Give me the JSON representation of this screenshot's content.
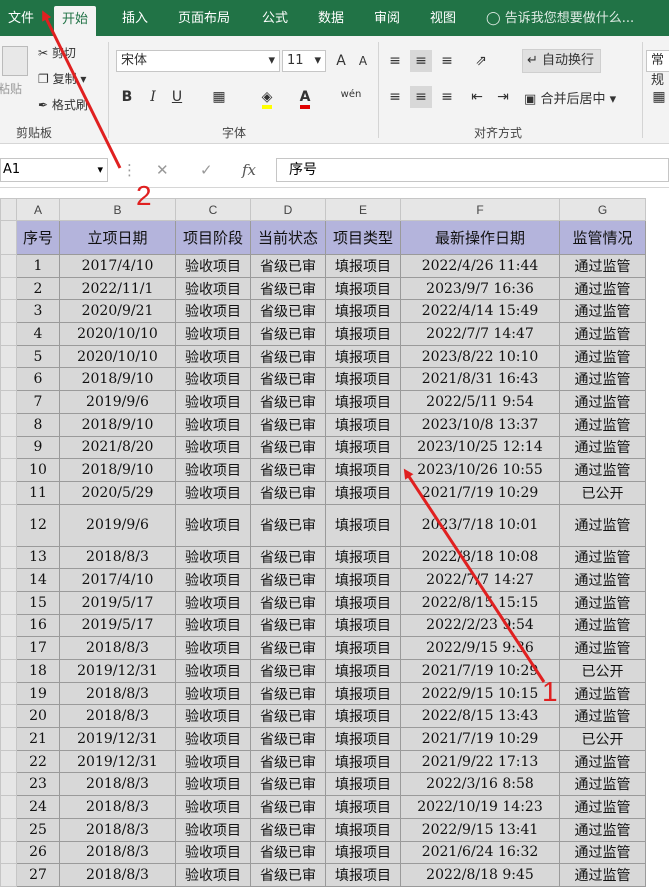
{
  "ribbon_tabs": [
    "文件",
    "开始",
    "插入",
    "页面布局",
    "公式",
    "数据",
    "审阅",
    "视图"
  ],
  "tell_me": "告诉我您想要做什么...",
  "clipboard": {
    "paste": "粘贴",
    "cut": "剪切",
    "copy": "复制",
    "format_painter": "格式刷",
    "label": "剪贴板"
  },
  "font": {
    "name": "宋体",
    "size": "11",
    "grow": "A",
    "shrink": "A",
    "bold": "B",
    "italic": "I",
    "underline": "U",
    "label": "字体",
    "phonetic": "wén"
  },
  "alignment": {
    "wrap": "自动换行",
    "merge": "合并后居中",
    "label": "对齐方式"
  },
  "number": {
    "format": "常规"
  },
  "formula_bar": {
    "name_box": "A1",
    "fx": "fx",
    "content": "序号"
  },
  "columns": [
    "A",
    "B",
    "C",
    "D",
    "E",
    "F",
    "G"
  ],
  "header_row": [
    "序号",
    "立项日期",
    "项目阶段",
    "当前状态",
    "项目类型",
    "最新操作日期",
    "监管情况"
  ],
  "rows": [
    [
      "1",
      "2017/4/10",
      "验收项目",
      "省级已审",
      "填报项目",
      "2022/4/26 11:44",
      "通过监管"
    ],
    [
      "2",
      "2022/11/1",
      "验收项目",
      "省级已审",
      "填报项目",
      "2023/9/7 16:36",
      "通过监管"
    ],
    [
      "3",
      "2020/9/21",
      "验收项目",
      "省级已审",
      "填报项目",
      "2022/4/14 15:49",
      "通过监管"
    ],
    [
      "4",
      "2020/10/10",
      "验收项目",
      "省级已审",
      "填报项目",
      "2022/7/7 14:47",
      "通过监管"
    ],
    [
      "5",
      "2020/10/10",
      "验收项目",
      "省级已审",
      "填报项目",
      "2023/8/22 10:10",
      "通过监管"
    ],
    [
      "6",
      "2018/9/10",
      "验收项目",
      "省级已审",
      "填报项目",
      "2021/8/31 16:43",
      "通过监管"
    ],
    [
      "7",
      "2019/9/6",
      "验收项目",
      "省级已审",
      "填报项目",
      "2022/5/11 9:54",
      "通过监管"
    ],
    [
      "8",
      "2018/9/10",
      "验收项目",
      "省级已审",
      "填报项目",
      "2023/10/8 13:37",
      "通过监管"
    ],
    [
      "9",
      "2021/8/20",
      "验收项目",
      "省级已审",
      "填报项目",
      "2023/10/25 12:14",
      "通过监管"
    ],
    [
      "10",
      "2018/9/10",
      "验收项目",
      "省级已审",
      "填报项目",
      "2023/10/26 10:55",
      "通过监管"
    ],
    [
      "11",
      "2020/5/29",
      "验收项目",
      "省级已审",
      "填报项目",
      "2021/7/19 10:29",
      "已公开"
    ],
    [
      "12",
      "2019/9/6",
      "验收项目",
      "省级已审",
      "填报项目",
      "2023/7/18 10:01",
      "通过监管"
    ],
    [
      "13",
      "2018/8/3",
      "验收项目",
      "省级已审",
      "填报项目",
      "2022/8/18 10:08",
      "通过监管"
    ],
    [
      "14",
      "2017/4/10",
      "验收项目",
      "省级已审",
      "填报项目",
      "2022/7/7 14:27",
      "通过监管"
    ],
    [
      "15",
      "2019/5/17",
      "验收项目",
      "省级已审",
      "填报项目",
      "2022/8/15 15:15",
      "通过监管"
    ],
    [
      "16",
      "2019/5/17",
      "验收项目",
      "省级已审",
      "填报项目",
      "2022/2/23 9:54",
      "通过监管"
    ],
    [
      "17",
      "2018/8/3",
      "验收项目",
      "省级已审",
      "填报项目",
      "2022/9/15 9:36",
      "通过监管"
    ],
    [
      "18",
      "2019/12/31",
      "验收项目",
      "省级已审",
      "填报项目",
      "2021/7/19 10:29",
      "已公开"
    ],
    [
      "19",
      "2018/8/3",
      "验收项目",
      "省级已审",
      "填报项目",
      "2022/9/15 10:15",
      "通过监管"
    ],
    [
      "20",
      "2018/8/3",
      "验收项目",
      "省级已审",
      "填报项目",
      "2022/8/15 13:43",
      "通过监管"
    ],
    [
      "21",
      "2019/12/31",
      "验收项目",
      "省级已审",
      "填报项目",
      "2021/7/19 10:29",
      "已公开"
    ],
    [
      "22",
      "2019/12/31",
      "验收项目",
      "省级已审",
      "填报项目",
      "2021/9/22 17:13",
      "通过监管"
    ],
    [
      "23",
      "2018/8/3",
      "验收项目",
      "省级已审",
      "填报项目",
      "2022/3/16 8:58",
      "通过监管"
    ],
    [
      "24",
      "2018/8/3",
      "验收项目",
      "省级已审",
      "填报项目",
      "2022/10/19 14:23",
      "通过监管"
    ],
    [
      "25",
      "2018/8/3",
      "验收项目",
      "省级已审",
      "填报项目",
      "2022/9/15 13:41",
      "通过监管"
    ],
    [
      "26",
      "2018/8/3",
      "验收项目",
      "省级已审",
      "填报项目",
      "2021/6/24 16:32",
      "通过监管"
    ],
    [
      "27",
      "2018/8/3",
      "验收项目",
      "省级已审",
      "填报项目",
      "2022/8/18 9:45",
      "通过监管"
    ]
  ],
  "annotations": {
    "label_1": "1",
    "label_2": "2",
    "color": "#e02020"
  },
  "colors": {
    "ribbon": "#217346",
    "header_fill": "#b4b4dc",
    "cell_fill": "#d8d8d8"
  }
}
